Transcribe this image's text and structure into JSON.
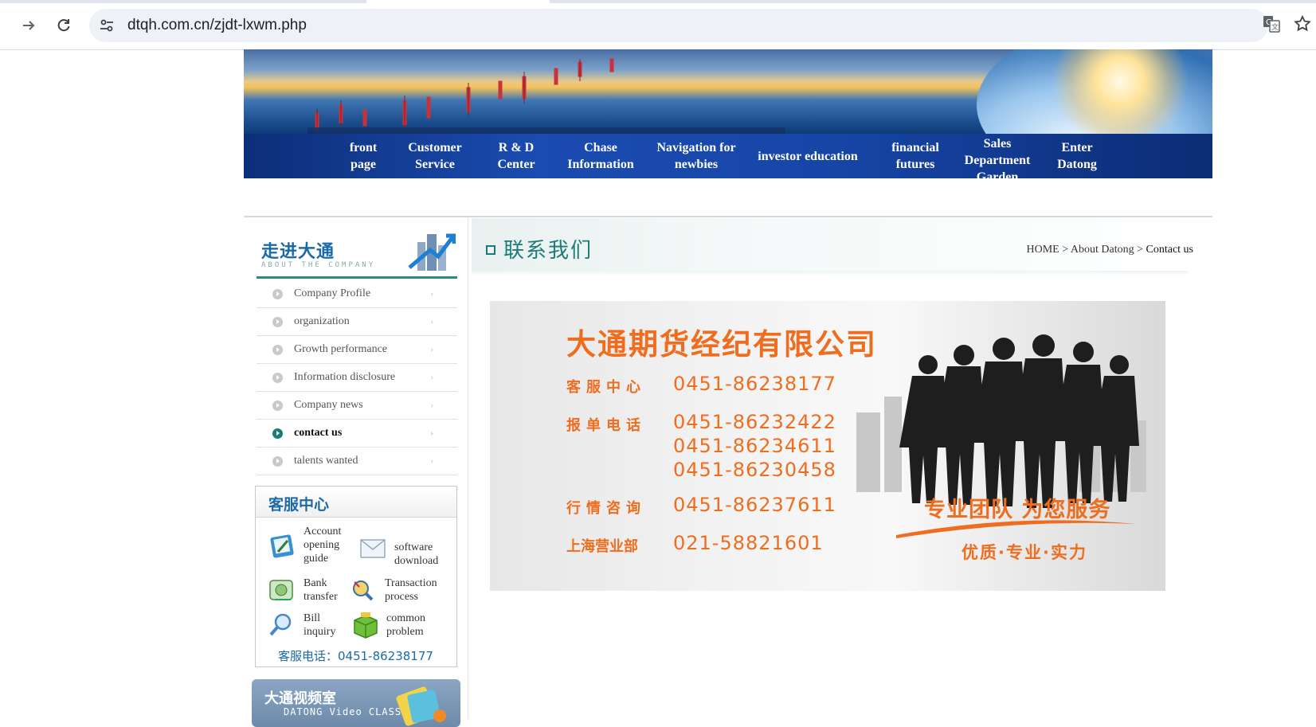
{
  "browser": {
    "url": "dtqh.com.cn/zjdt-lxwm.php",
    "forward_icon": "arrow-right-icon",
    "reload_icon": "reload-icon",
    "site_info_icon": "tune-icon",
    "translate_icon": "translate-icon",
    "bookmark_icon": "star-icon"
  },
  "nav": {
    "items": [
      {
        "label": "front page",
        "lines": [
          "front",
          "page"
        ]
      },
      {
        "label": "Customer Service",
        "lines": [
          "Customer",
          "Service"
        ]
      },
      {
        "label": "R & D Center",
        "lines": [
          "R & D",
          "Center"
        ]
      },
      {
        "label": "Chase Information",
        "lines": [
          "Chase",
          "Information"
        ]
      },
      {
        "label": "Navigation for newbies",
        "lines": [
          "Navigation for",
          "newbies"
        ]
      },
      {
        "label": "investor education",
        "lines": [
          "investor education"
        ]
      },
      {
        "label": "financial futures",
        "lines": [
          "financial",
          "futures"
        ]
      },
      {
        "label": "Sales Department Garden",
        "lines": [
          "Sales",
          "Department",
          "Garden"
        ]
      },
      {
        "label": "Enter Datong",
        "lines": [
          "Enter",
          "Datong"
        ]
      }
    ]
  },
  "sidebar": {
    "title": "走进大通",
    "subtitle": "ABOUT THE COMPANY",
    "items": [
      {
        "label": "Company Profile",
        "active": false
      },
      {
        "label": "organization",
        "active": false
      },
      {
        "label": "Growth performance",
        "active": false
      },
      {
        "label": "Information disclosure",
        "active": false
      },
      {
        "label": "Company news",
        "active": false
      },
      {
        "label": "contact us",
        "active": true
      },
      {
        "label": "talents wanted",
        "active": false
      }
    ],
    "arrow": "›"
  },
  "service": {
    "title": "客服中心",
    "links": [
      {
        "lines": [
          "Account",
          "opening",
          "guide"
        ],
        "icon": "guide-book-icon"
      },
      {
        "lines": [
          "software",
          "download"
        ],
        "icon": "envelope-icon"
      },
      {
        "lines": [
          "Bank",
          "transfer"
        ],
        "icon": "bank-transfer-icon"
      },
      {
        "lines": [
          "Transaction",
          "process"
        ],
        "icon": "magnifier-arrow-icon"
      },
      {
        "lines": [
          "Bill",
          "inquiry"
        ],
        "icon": "magnifier-icon"
      },
      {
        "lines": [
          "common",
          "problem"
        ],
        "icon": "green-box-icon"
      }
    ],
    "phone": "客服电话：0451-86238177"
  },
  "video": {
    "title": "大通视频室",
    "subtitle": "DATONG Video CLASS"
  },
  "content": {
    "page_title": "联系我们",
    "breadcrumb": {
      "home": "HOME",
      "sep": " > ",
      "about": "About Datong",
      "current": "Contact us"
    },
    "company": "大通期货经纪有限公司",
    "contacts": [
      {
        "label": "客服中心",
        "numbers": [
          "0451-86238177"
        ]
      },
      {
        "label": "报单电话",
        "numbers": [
          "0451-86232422",
          "0451-86234611",
          "0451-86230458"
        ]
      },
      {
        "label": "行情咨询",
        "numbers": [
          "0451-86237611"
        ]
      },
      {
        "label": "上海营业部",
        "numbers": [
          "021-58821601"
        ]
      }
    ],
    "slogan": "专业团队 为您服务",
    "slogan2": "优质·专业·实力"
  },
  "colors": {
    "accent_orange": "#ef6d1f",
    "teal": "#1b7c77",
    "nav_blue": "#1a4bb0",
    "link_blue": "#1b6aa8"
  }
}
